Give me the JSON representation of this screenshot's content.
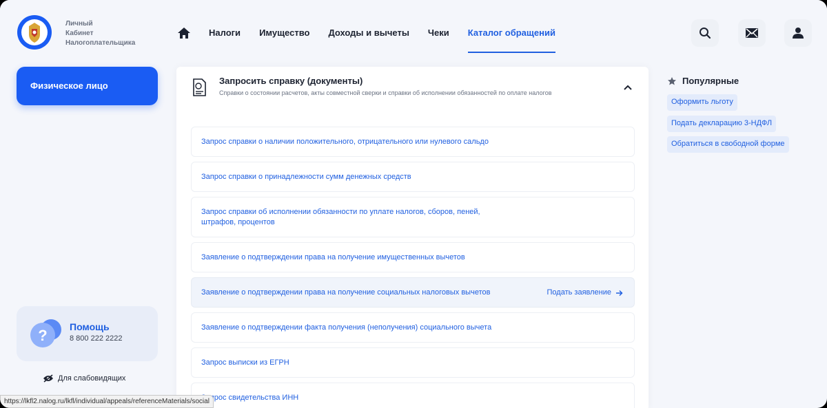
{
  "header": {
    "logo_lines": [
      "Личный",
      "Кабинет",
      "Налогоплательщика"
    ],
    "nav": [
      {
        "label": "Налоги",
        "active": false
      },
      {
        "label": "Имущество",
        "active": false
      },
      {
        "label": "Доходы и вычеты",
        "active": false
      },
      {
        "label": "Чеки",
        "active": false
      },
      {
        "label": "Каталог обращений",
        "active": true
      }
    ],
    "icons": [
      "home-icon",
      "search-icon",
      "mail-icon",
      "user-icon"
    ]
  },
  "sidebar": {
    "person_type": "Физическое лицо",
    "help": {
      "title": "Помощь",
      "phone": "8 800 222 2222"
    },
    "low_vision": "Для слабовидящих"
  },
  "section": {
    "title": "Запросить справку (документы)",
    "subtitle": "Справки о состоянии расчетов, акты совместной сверки и справки об исполнении обязанностей по оплате налогов",
    "items": [
      {
        "label": "Запрос справки о наличии положительного, отрицательного или нулевого сальдо"
      },
      {
        "label": "Запрос справки о принадлежности сумм денежных средств"
      },
      {
        "label": "Запрос справки об исполнении обязанности по уплате налогов, сборов, пеней, штрафов, процентов"
      },
      {
        "label": "Заявление о подтверждении права на получение имущественных вычетов"
      },
      {
        "label": "Заявление о подтверждении права на получение социальных налоговых вычетов",
        "action": "Подать заявление"
      },
      {
        "label": "Заявление о подтверждении факта получения (неполучения) социального вычета"
      },
      {
        "label": "Запрос выписки из ЕГРН"
      },
      {
        "label": "Запрос свидетельства ИНН"
      }
    ]
  },
  "popular": {
    "title": "Популярные",
    "tags": [
      "Оформить льготу",
      "Подать декларацию 3-НДФЛ",
      "Обратиться в свободной форме"
    ]
  },
  "status_url": "https://lkfl2.nalog.ru/lkfl/individual/appeals/referenceMaterials/social",
  "colors": {
    "accent": "#1f5fe0",
    "primary_button": "#1a5cf3",
    "background": "#f4f6fb"
  }
}
